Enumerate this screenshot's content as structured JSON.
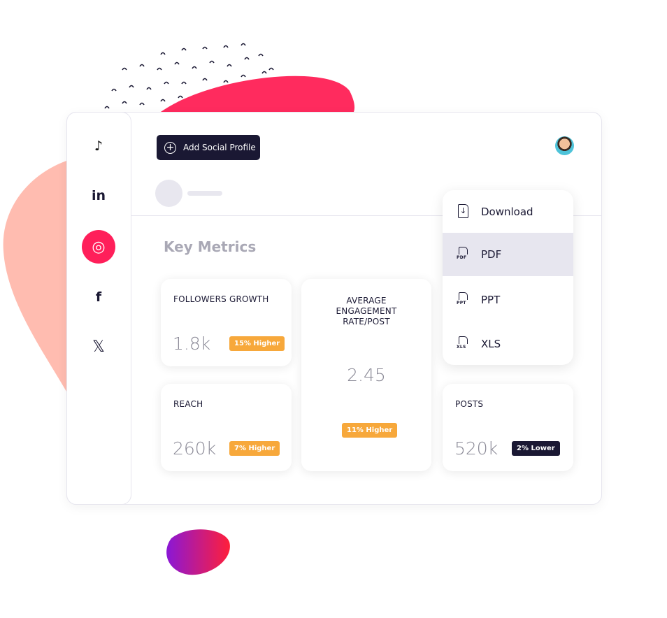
{
  "header": {
    "add_profile_label": "Add Social Profile"
  },
  "sidebar": {
    "items": [
      {
        "name": "tiktok",
        "label": "♪"
      },
      {
        "name": "linkedin",
        "label": "in"
      },
      {
        "name": "instagram",
        "label": "◎",
        "active": true
      },
      {
        "name": "facebook",
        "label": "f"
      },
      {
        "name": "x",
        "label": "𝕏"
      }
    ]
  },
  "main": {
    "title": "Key Metrics",
    "cards": {
      "followers": {
        "label": "FOLLOWERS GROWTH",
        "value": "1.8k",
        "badge": "15% Higher"
      },
      "reach": {
        "label": "REACH",
        "value": "260k",
        "badge": "7% Higher"
      },
      "engagement": {
        "label": "AVERAGE ENGAGEMENT RATE/POST",
        "value": "2.45",
        "badge": "11% Higher"
      },
      "posts": {
        "label": "POSTS",
        "value": "520k",
        "badge": "2% Lower"
      }
    }
  },
  "download_menu": {
    "title": "Download",
    "items": [
      {
        "label": "PDF",
        "icon": "PDF",
        "selected": true
      },
      {
        "label": "PPT",
        "icon": "PPT"
      },
      {
        "label": "XLS",
        "icon": "XLS"
      }
    ]
  },
  "colors": {
    "accent": "#ff1f5a",
    "dark": "#1a1833",
    "badge_orange": "#f7a83b"
  }
}
